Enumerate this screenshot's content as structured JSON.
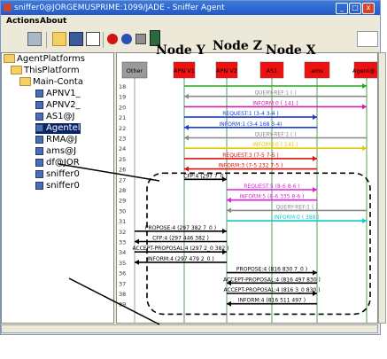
{
  "window": {
    "title": "sniffer0@JORGEMUSPRIME:1099/JADE - Sniffer Agent",
    "btn_min": "_",
    "btn_max": "□",
    "btn_close": "x"
  },
  "menu": {
    "actions": "Actions",
    "about": "About"
  },
  "tree": {
    "root": "AgentPlatforms",
    "platform": "ThisPlatform",
    "container": "Main-Conta",
    "agents": [
      "APNV1_",
      "APNV2_",
      "AS1@J",
      "Agentel",
      "RMA@J",
      "ams@J",
      "df@JOR",
      "sniffer0",
      "sniffer0"
    ]
  },
  "node_labels": {
    "y": "Node Y",
    "z": "Node Z",
    "x": "Node X"
  },
  "agents_header": [
    "Other",
    "APN V1",
    "APN V2",
    "AS1",
    "ams",
    "Agent@..."
  ],
  "row_numbers": [
    "18",
    "19",
    "20",
    "21",
    "22",
    "23",
    "24",
    "25",
    "26",
    "27",
    "28",
    "29",
    "30",
    "31",
    "32",
    "33",
    "34",
    "35",
    "36",
    "37",
    "38",
    "39"
  ],
  "messages": [
    {
      "label": "",
      "color": "#22aa22"
    },
    {
      "label": "QUERY-REF:1 (   )",
      "color": "#888888"
    },
    {
      "label": "INFORM:0 (  141  )",
      "color": "#cc22aa"
    },
    {
      "label": "REQUEST:1 (3-4  3-4  )",
      "color": "#1a3ad8"
    },
    {
      "label": "INFORM:1 (3-4  168  3-4)",
      "color": "#1a3ad8"
    },
    {
      "label": "QUERY-REF:1 (   )",
      "color": "#888888"
    },
    {
      "label": "INFORM:0 (  141  )",
      "color": "#e8c800"
    },
    {
      "label": "REQUEST:3 (7-5  7-5  )",
      "color": "#dd1111"
    },
    {
      "label": "INFORM:3 (7-5  232  7-5  )",
      "color": "#dd1111"
    },
    {
      "label": "CFP:4 (297  7_0  )",
      "color": "#000000"
    },
    {
      "label": "REQUEST:5 (8-6  8-6  )",
      "color": "#dd22dd"
    },
    {
      "label": "INFORM:5 (8-6  335  8-6  )",
      "color": "#dd22dd"
    },
    {
      "label": "QUERY-REF:1 (   )",
      "color": "#888888"
    },
    {
      "label": "INFORM:0 (  388  )",
      "color": "#11cccc"
    },
    {
      "label": "PROPOSE:4 (297  382  7_0  )",
      "color": "#000000"
    },
    {
      "label": "CFP:4 (297  446  382  )",
      "color": "#000000"
    },
    {
      "label": "ACCEPT-PROPOSAL:4 (297  2_0  382  )",
      "color": "#000000"
    },
    {
      "label": "INFORM:4 (297  479  2_0  )",
      "color": "#000000"
    },
    {
      "label": "PROPOSE:4 (816  830  7_0  )",
      "color": "#000000"
    },
    {
      "label": "ACCEPT-PROPOSAL:4 (816  497  830  )",
      "color": "#000000"
    },
    {
      "label": "ACCEPT-PROPOSAL:4 (816  3_0  830  )",
      "color": "#000000"
    },
    {
      "label": "INFORM:4 (816  511  497  )",
      "color": "#000000"
    }
  ]
}
